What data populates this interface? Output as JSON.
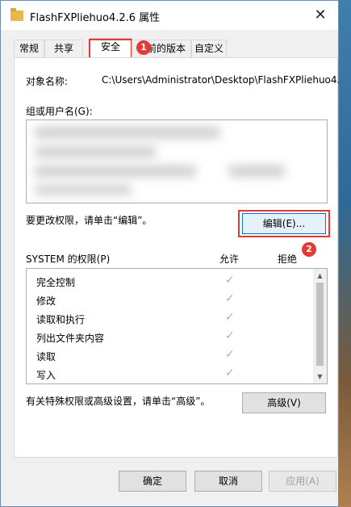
{
  "window": {
    "title": "FlashFXPliehuo4.2.6 属性",
    "close": "✕"
  },
  "tabs": [
    {
      "label": "常规"
    },
    {
      "label": "共享"
    },
    {
      "label": "安全"
    },
    {
      "label": "以前的版本"
    },
    {
      "label": "自定义"
    }
  ],
  "active_tab_index": 2,
  "annotations": {
    "badge1": "1",
    "badge2": "2",
    "highlight_color": "#e53935"
  },
  "security": {
    "object_name_label": "对象名称:",
    "object_name_value": "C:\\Users\\Administrator\\Desktop\\FlashFXPliehuo4.",
    "group_label": "组或用户名(G):",
    "edit_hint": "要更改权限，请单击“编辑”。",
    "edit_button": "编辑(E)...",
    "perm_label": "SYSTEM 的权限(P)",
    "allow_header": "允许",
    "deny_header": "拒绝",
    "permissions": [
      {
        "name": "完全控制",
        "allow": "✓"
      },
      {
        "name": "修改",
        "allow": "✓"
      },
      {
        "name": "读取和执行",
        "allow": "✓"
      },
      {
        "name": "列出文件夹内容",
        "allow": "✓"
      },
      {
        "name": "读取",
        "allow": "✓"
      },
      {
        "name": "写入",
        "allow": "✓"
      }
    ],
    "advanced_hint": "有关特殊权限或高级设置，请单击“高级”。",
    "advanced_button": "高级(V)"
  },
  "footer": {
    "ok": "确定",
    "cancel": "取消",
    "apply": "应用(A)"
  }
}
